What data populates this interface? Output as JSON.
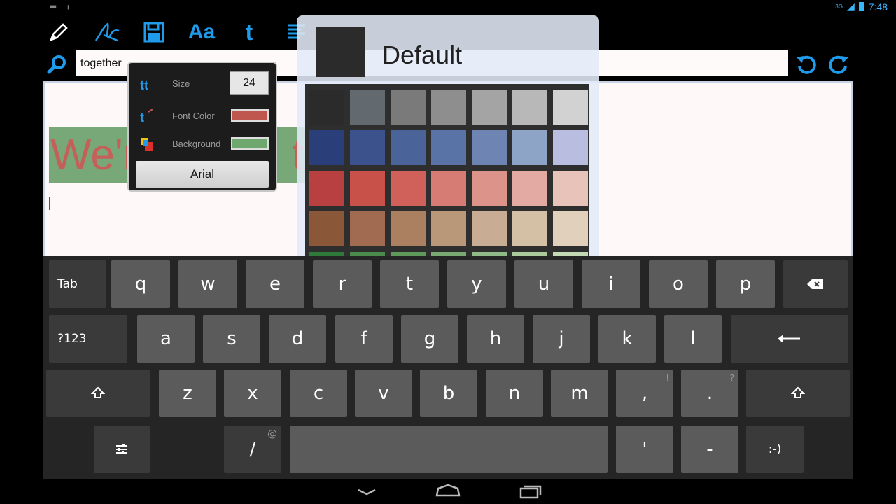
{
  "status": {
    "time": "7:48",
    "network": "3G"
  },
  "search": {
    "value": "together"
  },
  "document": {
    "text": "We're going together..."
  },
  "format_popup": {
    "size_label": "Size",
    "size_value": "24",
    "font_color_label": "Font Color",
    "background_label": "Background",
    "font_button": "Arial",
    "font_color": "#c0574f",
    "background_color": "#6fa86f"
  },
  "color_picker": {
    "title": "Default",
    "rows": [
      [
        "#2b2b2b",
        "#626a70",
        "#7a7a7a",
        "#8e8e8e",
        "#a4a4a4",
        "#b8b8b8",
        "#d2d2d2"
      ],
      [
        "#2a3e7a",
        "#3b528c",
        "#4a6398",
        "#5a73a6",
        "#6e84b2",
        "#8ea4c6",
        "#b9bde0"
      ],
      [
        "#b84040",
        "#c8524a",
        "#d0605a",
        "#d67c74",
        "#dc938a",
        "#e2aaa2",
        "#e8c3ba"
      ],
      [
        "#8a5838",
        "#a06b50",
        "#aa8060",
        "#b89878",
        "#c8ad94",
        "#d4c0a4",
        "#e0d0bc"
      ],
      [
        "#2f7a3a",
        "#4a8a4a",
        "#5f9a5a",
        "#79aa72",
        "#90ba88",
        "#aaca9c",
        "#c4dab4"
      ]
    ]
  },
  "keyboard": {
    "row1": [
      "Tab",
      "q",
      "w",
      "e",
      "r",
      "t",
      "y",
      "u",
      "i",
      "o",
      "p"
    ],
    "row2": [
      "?123",
      "a",
      "s",
      "d",
      "f",
      "g",
      "h",
      "j",
      "k",
      "l"
    ],
    "row3": [
      "z",
      "x",
      "c",
      "v",
      "b",
      "n",
      "m",
      ",",
      "."
    ],
    "row3_sup": [
      "!",
      "?"
    ],
    "row4": [
      "/",
      "'",
      "-",
      ":-)"
    ],
    "row4_sup": [
      "@"
    ]
  }
}
